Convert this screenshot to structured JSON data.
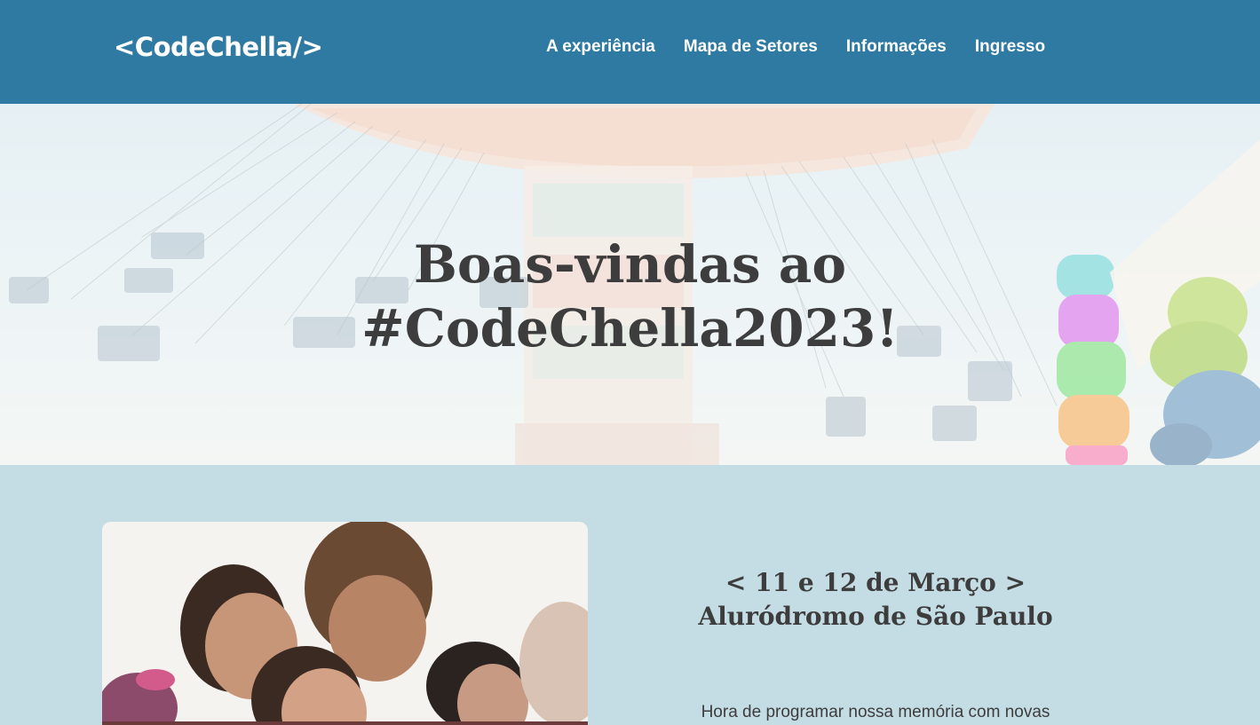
{
  "header": {
    "logo": "<CodeChella/>",
    "nav": [
      {
        "label": "A experiência"
      },
      {
        "label": "Mapa de Setores"
      },
      {
        "label": "Informações"
      },
      {
        "label": "Ingresso"
      }
    ]
  },
  "hero": {
    "title_line1": "Boas-vindas ao",
    "title_line2": "#CodeChella2023!"
  },
  "event": {
    "dates": "< 11 e 12 de Março >",
    "venue": "Aluródromo de São Paulo",
    "description": "Hora de programar nossa memória com novas"
  },
  "colors": {
    "header_bg": "#2e7aa3",
    "page_bg": "#c4dce4",
    "text": "#3d3d3d"
  }
}
